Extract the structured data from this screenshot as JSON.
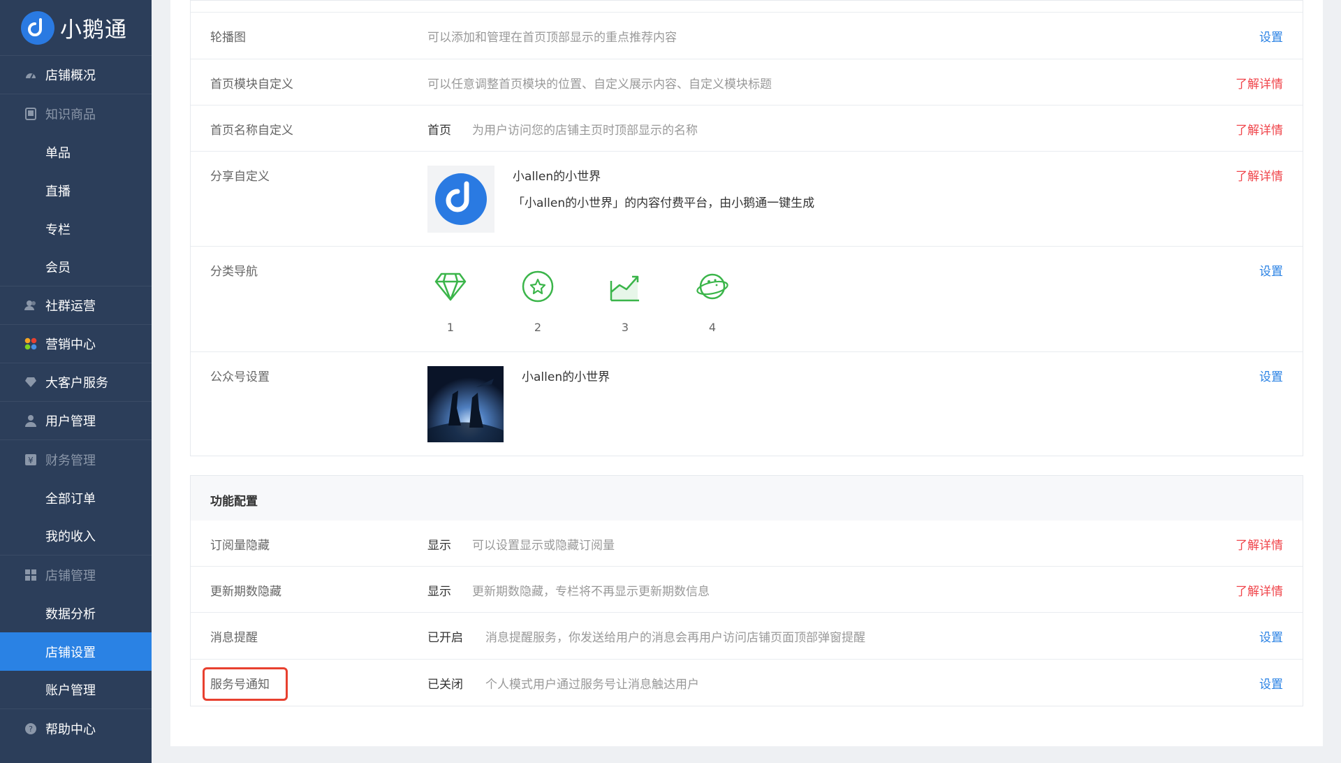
{
  "brand": {
    "name": "小鹅通",
    "logo_icon": "goose-icon",
    "color": "#2a7ae2"
  },
  "sidebar": {
    "items": [
      {
        "label": "店铺概况",
        "icon": "dashboard-icon"
      },
      {
        "label": "知识商品",
        "icon": "tablet-icon"
      },
      {
        "label": "单品"
      },
      {
        "label": "直播"
      },
      {
        "label": "专栏"
      },
      {
        "label": "会员"
      },
      {
        "label": "社群运营",
        "icon": "users-icon"
      },
      {
        "label": "营销中心",
        "icon": "apps-icon"
      },
      {
        "label": "大客户服务",
        "icon": "diamond-icon"
      },
      {
        "label": "用户管理",
        "icon": "user-icon"
      },
      {
        "label": "财务管理",
        "icon": "finance-icon"
      },
      {
        "label": "全部订单"
      },
      {
        "label": "我的收入"
      },
      {
        "label": "店铺管理",
        "icon": "grid-icon"
      },
      {
        "label": "数据分析"
      },
      {
        "label": "店铺设置"
      },
      {
        "label": "账户管理"
      },
      {
        "label": "帮助中心",
        "icon": "help-icon"
      }
    ],
    "active": "店铺设置"
  },
  "homepage": {
    "carousel": {
      "label": "轮播图",
      "desc": "可以添加和管理在首页顶部显示的重点推荐内容",
      "action": "设置"
    },
    "module": {
      "label": "首页模块自定义",
      "desc": "可以任意调整首页模块的位置、自定义展示内容、自定义模块标题",
      "action": "了解详情"
    },
    "name": {
      "label": "首页名称自定义",
      "value": "首页",
      "desc": "为用户访问您的店铺主页时顶部显示的名称",
      "action": "了解详情"
    },
    "share": {
      "label": "分享自定义",
      "title": "小allen的小世界",
      "desc": "「小allen的小世界」的内容付费平台，由小鹅通一键生成",
      "action": "了解详情"
    },
    "category": {
      "label": "分类导航",
      "items": [
        "1",
        "2",
        "3",
        "4"
      ],
      "icons": [
        "diamond-icon",
        "star-icon",
        "chart-icon",
        "planet-icon"
      ],
      "action": "设置"
    },
    "official": {
      "label": "公众号设置",
      "name": "小allen的小世界",
      "action": "设置"
    }
  },
  "features": {
    "title": "功能配置",
    "rows": [
      {
        "label": "订阅量隐藏",
        "value": "显示",
        "desc": "可以设置显示或隐藏订阅量",
        "action": "了解详情"
      },
      {
        "label": "更新期数隐藏",
        "value": "显示",
        "desc": "更新期数隐藏，专栏将不再显示更新期数信息",
        "action": "了解详情"
      },
      {
        "label": "消息提醒",
        "value": "已开启",
        "desc": "消息提醒服务，你发送给用户的消息会再用户访问店铺页面顶部弹窗提醒",
        "action": "设置"
      },
      {
        "label": "服务号通知",
        "value": "已关闭",
        "desc": "个人模式用户通过服务号让消息触达用户",
        "action": "设置"
      }
    ]
  },
  "colors": {
    "sidebar": "#2c3e5a",
    "active": "#2a82e4",
    "link": "#2a82e4",
    "detail": "#f0454b",
    "highlight": "#e8402f"
  }
}
